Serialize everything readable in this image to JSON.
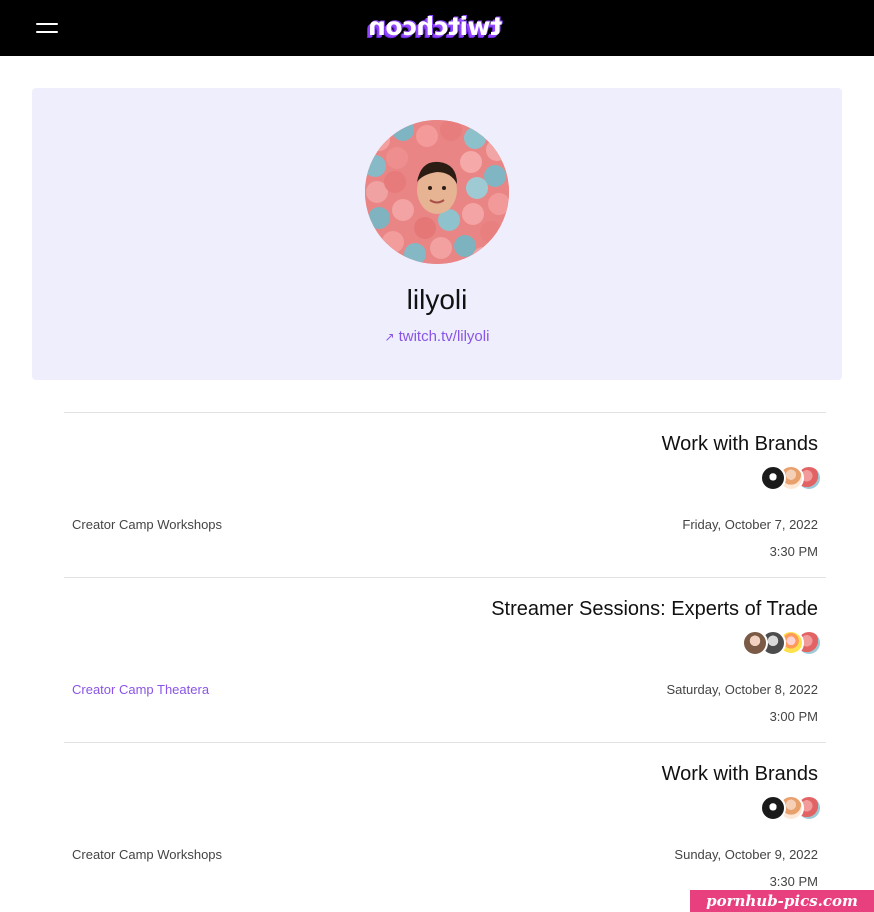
{
  "header": {
    "logo_text": "twitchcon",
    "menu_icon": "hamburger-menu-icon"
  },
  "profile": {
    "name": "lilyoli",
    "link": "twitch.tv/lilyoli",
    "link_icon": "external-arrow-icon"
  },
  "sessions": [
    {
      "title": "Work with Brands",
      "date": "Friday, October 7, 2022",
      "time": "3:30 PM",
      "track": "Creator Camp Workshops",
      "track_is_link": false
    },
    {
      "title": "Streamer Sessions: Experts of Trade",
      "date": "Saturday, October 8, 2022",
      "time": "3:00 PM",
      "track": "Creator Camp Theatera",
      "track_is_link": true
    },
    {
      "title": "Work with Brands",
      "date": "Sunday, October 9, 2022",
      "time": "3:30 PM",
      "track": "Creator Camp Workshops",
      "track_is_link": false
    }
  ],
  "watermark": "pornhub-pics.com",
  "colors": {
    "header_bg": "#000000",
    "brand_purple": "#9146ff",
    "card_bg": "#eeeefd",
    "link": "#8a55e6",
    "watermark_bg": "#e8407e"
  }
}
